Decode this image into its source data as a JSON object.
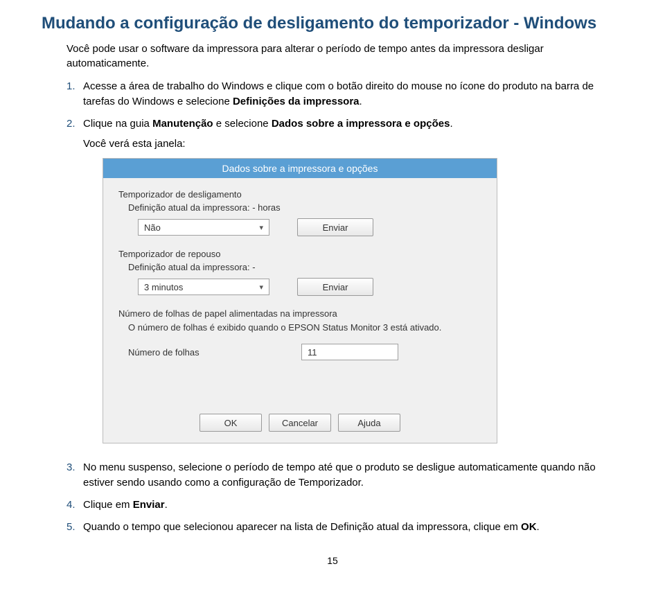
{
  "page": {
    "title": "Mudando a configuração de desligamento do temporizador - Windows",
    "intro": "Você pode usar o software da impressora para alterar o período de tempo antes da impressora desligar automaticamente.",
    "page_number": "15"
  },
  "steps": {
    "s1": {
      "num": "1.",
      "before": "Acesse a área de trabalho do Windows e clique com o botão direito do mouse no ícone do produto na barra de tarefas do Windows e selecione ",
      "bold": "Definições da impressora",
      "after": "."
    },
    "s2": {
      "num": "2.",
      "before": "Clique na guia ",
      "bold1": "Manutenção",
      "mid": " e selecione ",
      "bold2": "Dados sobre a impressora e opções",
      "after": ".",
      "sub": "Você verá esta janela:"
    },
    "s3": {
      "num": "3.",
      "text": "No menu suspenso, selecione o período de tempo até que o produto se desligue automaticamente quando não estiver sendo usando como a configuração de Temporizador."
    },
    "s4": {
      "num": "4.",
      "before": "Clique em ",
      "bold": "Enviar",
      "after": "."
    },
    "s5": {
      "num": "5.",
      "before": "Quando o tempo que selecionou aparecer na lista de Definição atual da impressora, clique em ",
      "bold": "OK",
      "after": "."
    }
  },
  "dialog": {
    "title": "Dados sobre a impressora e opções",
    "shutoff_label": "Temporizador de desligamento",
    "shutoff_def": "Definição atual da impressora: - horas",
    "shutoff_value": "Não",
    "send_btn": "Enviar",
    "sleep_label": "Temporizador de repouso",
    "sleep_def": "Definição atual da impressora: -",
    "sleep_value": "3 minutos",
    "sheets_label": "Número de folhas de papel alimentadas na impressora",
    "sheets_info": "O número de folhas é exibido quando o EPSON Status Monitor 3 está ativado.",
    "sheets_field_label": "Número de folhas",
    "sheets_value": "11",
    "ok": "OK",
    "cancel": "Cancelar",
    "help": "Ajuda"
  }
}
